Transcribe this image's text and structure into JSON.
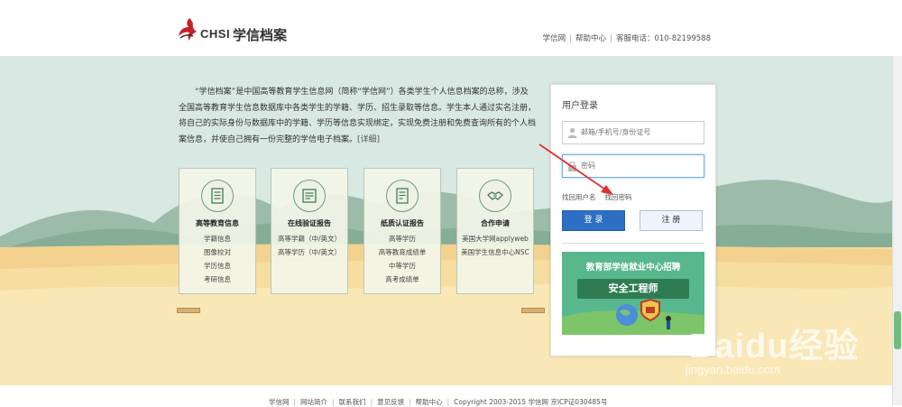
{
  "header": {
    "logo_text": "CHSI",
    "site_title": "学信档案",
    "nav": [
      "学信网",
      "帮助中心"
    ],
    "phone": "客服电话：010-82199588"
  },
  "intro": {
    "text": "“学信档案”是中国高等教育学生信息网（简称“学信网”）各类学生个人信息档案的总称，涉及全国高等教育学生信息数据库中各类学生的学籍、学历、招生录取等信息。学生本人通过实名注册，将自己的实际身份与数据库中的学籍、学历等信息实现绑定，实现免费注册和免费查询所有的个人档案信息，并使自己拥有一份完整的学信电子档案。",
    "more_link": "[详细]"
  },
  "cards": [
    {
      "title": "高等教育信息",
      "icon": "document-icon",
      "items": [
        "学籍信息",
        "图像校对",
        "学历信息",
        "考研信息"
      ]
    },
    {
      "title": "在线验证报告",
      "icon": "certificate-icon",
      "items": [
        "高等学籍（中/英文）",
        "高等学历（中/英文）"
      ]
    },
    {
      "title": "纸质认证报告",
      "icon": "report-icon",
      "items": [
        "高等学历",
        "高等教育成绩单",
        "中等学历",
        "高考成绩单"
      ]
    },
    {
      "title": "合作申请",
      "icon": "handshake-icon",
      "items": [
        "美国大学网applyweb",
        "美国学生信息中心NSC"
      ]
    }
  ],
  "login": {
    "title": "用户登录",
    "username_placeholder": "邮箱/手机号/身份证号",
    "password_placeholder": "密码",
    "find_username": "找回用户名",
    "find_password": "找回密码",
    "login_button": "登 录",
    "register_button": "注 册"
  },
  "banner": {
    "headline": "教育部学信就业中心招聘",
    "subtitle": "安全工程师"
  },
  "footer": {
    "links": [
      "学信网",
      "网站简介",
      "联系我们",
      "意见反馈",
      "帮助中心"
    ],
    "copyright": "Copyright 2003-2015 学信网 京ICP证030485号"
  },
  "watermark": {
    "brand": "Baidu经验",
    "url": "jingyan.baidu.com"
  },
  "colors": {
    "accent_blue": "#2d6fc3",
    "banner_green": "#58b78c",
    "sky": "#d8e8e3",
    "sand": "#f6dda0",
    "annotation_red": "#e03030"
  }
}
